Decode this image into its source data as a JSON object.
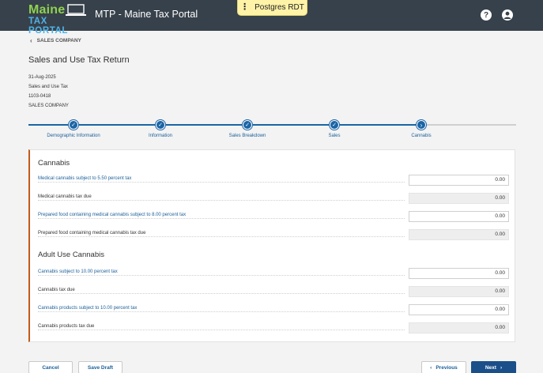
{
  "header": {
    "logo_line1": "Maine",
    "logo_line2": "TAX PORTAL",
    "title": "MTP - Maine Tax Portal",
    "env_badge": "Postgres RDT",
    "help_icon": "?",
    "colors": {
      "bar": "#37414b",
      "logo_green": "#8fd14f",
      "logo_blue": "#4fb3e8",
      "badge": "#fff3a8"
    }
  },
  "breadcrumb": {
    "label": "SALES COMPANY"
  },
  "page": {
    "title": "Sales and Use Tax Return",
    "meta": [
      "31-Aug-2025",
      "Sales and Use Tax",
      "1103-0418",
      "SALES COMPANY"
    ]
  },
  "stepper": {
    "steps": [
      {
        "label": "Demographic Information",
        "state": "complete"
      },
      {
        "label": "Information",
        "state": "complete"
      },
      {
        "label": "Sales Breakdown",
        "state": "complete"
      },
      {
        "label": "Sales",
        "state": "complete"
      },
      {
        "label": "Cannabis",
        "state": "current"
      }
    ],
    "accent": "#1b65a6"
  },
  "sections": [
    {
      "title": "Cannabis",
      "rows": [
        {
          "label": "Medical cannabis subject to 5.50 percent tax",
          "value": "0.00",
          "editable": true
        },
        {
          "label": "Medical cannabis tax due",
          "value": "0.00",
          "editable": false
        },
        {
          "label": "Prepared food containing medical cannabis subject to 8.00 percent tax",
          "value": "0.00",
          "editable": true
        },
        {
          "label": "Prepared food containing medical cannabis tax due",
          "value": "0.00",
          "editable": false
        }
      ]
    },
    {
      "title": "Adult Use Cannabis",
      "rows": [
        {
          "label": "Cannabis subject to 10.00 percent tax",
          "value": "0.00",
          "editable": true
        },
        {
          "label": "Cannabis tax due",
          "value": "0.00",
          "editable": false
        },
        {
          "label": "Cannabis products subject to 10.00 percent tax",
          "value": "0.00",
          "editable": true
        },
        {
          "label": "Cannabis products tax due",
          "value": "0.00",
          "editable": false
        }
      ]
    }
  ],
  "footer": {
    "cancel": "Cancel",
    "save_draft": "Save Draft",
    "previous": "Previous",
    "next": "Next"
  },
  "accent_colors": {
    "section_border": "#c35a1a",
    "primary_button": "#1b4f8a"
  }
}
